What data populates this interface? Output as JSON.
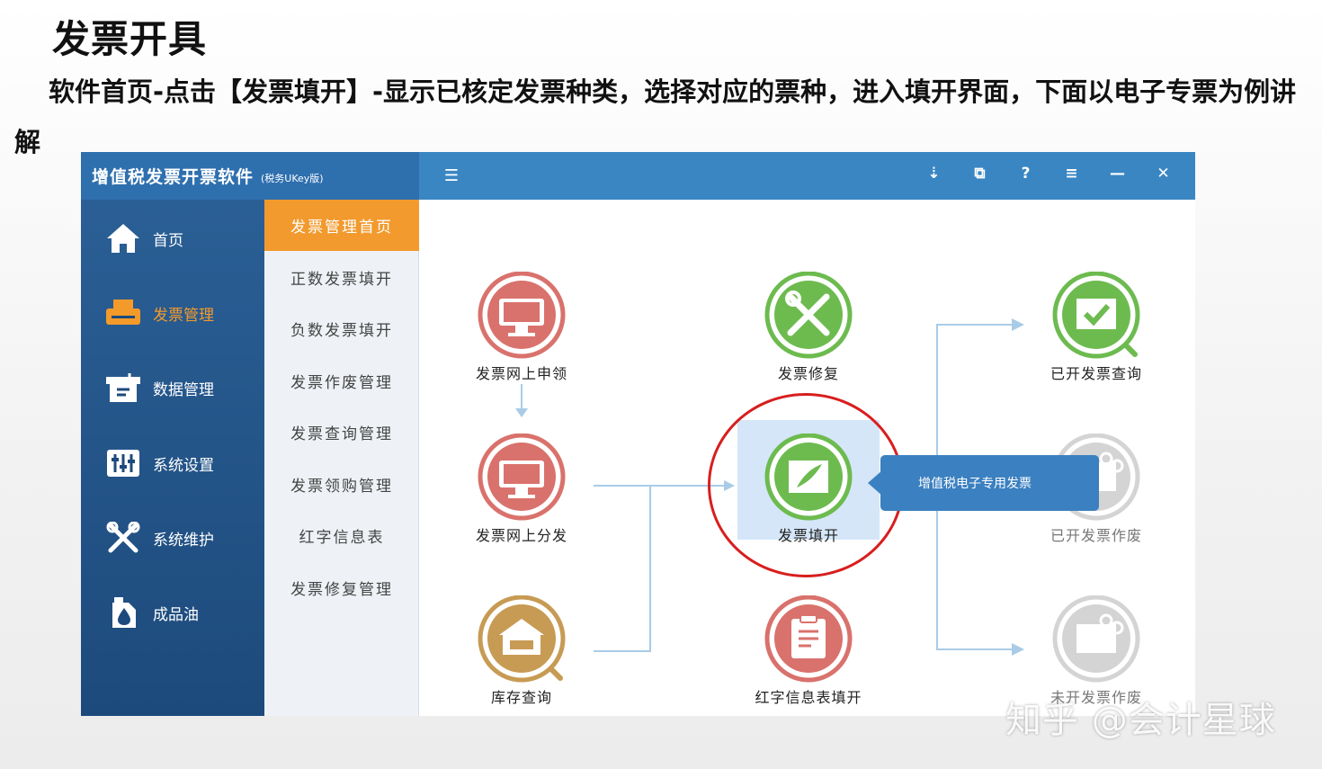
{
  "slide": {
    "title": "发票开具",
    "description": "软件首页-点击【发票填开】-显示已核定发票种类，选择对应的票种，进入填开界面，下面以电子专票为例讲解"
  },
  "app": {
    "name": "增值税发票开票软件",
    "edition": "(税务UKey版)",
    "window_buttons": [
      "⇣",
      "⧉",
      "?",
      "≡",
      "—",
      "✕"
    ],
    "menu_toggle": "☰"
  },
  "sidebar": {
    "items": [
      {
        "label": "首页",
        "icon": "home-icon"
      },
      {
        "label": "发票管理",
        "icon": "printer-icon",
        "active": true
      },
      {
        "label": "数据管理",
        "icon": "database-icon"
      },
      {
        "label": "系统设置",
        "icon": "sliders-icon"
      },
      {
        "label": "系统维护",
        "icon": "tools-icon"
      },
      {
        "label": "成品油",
        "icon": "oil-icon"
      }
    ]
  },
  "submenu": {
    "items": [
      {
        "label": "发票管理首页",
        "active": true
      },
      {
        "label": "正数发票填开"
      },
      {
        "label": "负数发票填开"
      },
      {
        "label": "发票作废管理"
      },
      {
        "label": "发票查询管理"
      },
      {
        "label": "发票领购管理"
      },
      {
        "label": "红字信息表"
      },
      {
        "label": "发票修复管理"
      }
    ]
  },
  "flow": {
    "nodes": [
      {
        "label": "发票网上申领",
        "icon": "monitor-icon",
        "color": "#d9726c"
      },
      {
        "label": "发票修复",
        "icon": "repair-tools-icon",
        "color": "#6dbb4f"
      },
      {
        "label": "已开发票查询",
        "icon": "search-check-icon",
        "color": "#6dbb4f"
      },
      {
        "label": "发票网上分发",
        "icon": "monitor-icon",
        "color": "#d9726c"
      },
      {
        "label": "发票填开",
        "icon": "feather-pen-icon",
        "color": "#6dbb4f"
      },
      {
        "label": "已开发票作废",
        "icon": "scissors-icon",
        "color": "#bdbdbd"
      },
      {
        "label": "库存查询",
        "icon": "warehouse-search-icon",
        "color": "#c79b54"
      },
      {
        "label": "红字信息表填开",
        "icon": "clipboard-pen-icon",
        "color": "#d9726c"
      },
      {
        "label": "未开发票作废",
        "icon": "scissors-icon",
        "color": "#bdbdbd"
      }
    ],
    "tooltip": "增值税电子专用发票"
  },
  "watermark": "知乎 @会计星球",
  "colors": {
    "titlebar": "#3a86c3",
    "sidebar": "#1d4a7c",
    "accent": "#f29a2e",
    "highlight": "#d81e1e"
  }
}
